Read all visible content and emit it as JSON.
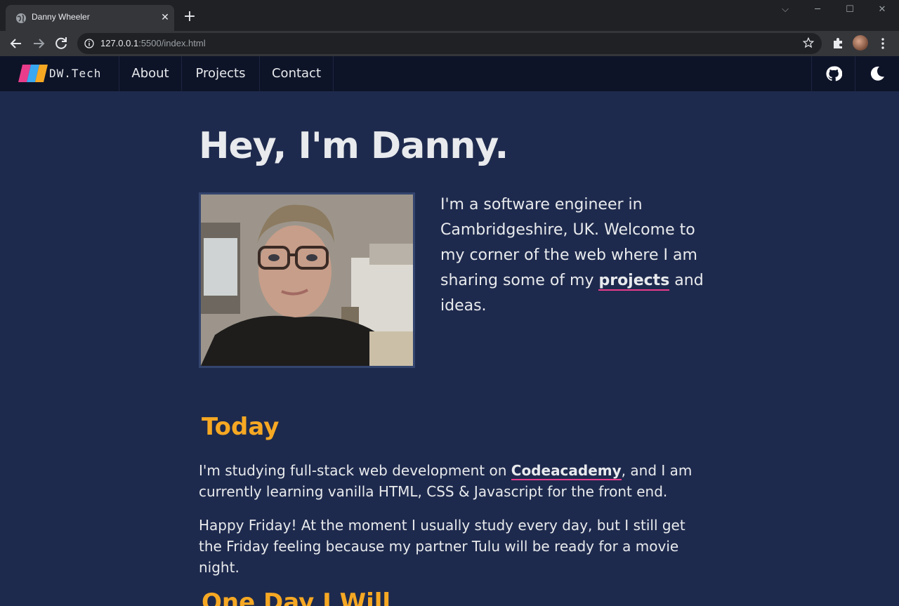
{
  "browser": {
    "tab_title": "Danny Wheeler",
    "new_tab_icon": "plus-icon",
    "url_host": "127.0.0.1",
    "url_rest": ":5500/index.html"
  },
  "site": {
    "logo_text": "DW.Tech",
    "nav": [
      "About",
      "Projects",
      "Contact"
    ],
    "icons": [
      "github-icon",
      "moon-icon"
    ],
    "colors": {
      "background": "#1e2a4d",
      "nav": "#0e1428",
      "accent": "#f6a823",
      "link_underline": "#e93d8c"
    }
  },
  "main": {
    "heading": "Hey, I'm Danny.",
    "intro_before": "I'm a software engineer in Cambridgeshire, UK. Welcome to my corner of the web where I am sharing some of my ",
    "intro_link": "projects",
    "intro_after": " and ideas.",
    "today_title": "Today",
    "today_p1_before": "I'm studying full-stack web development on ",
    "today_p1_link": "Codeacademy",
    "today_p1_after": ", and I am currently learning vanilla HTML, CSS & Javascript for the front end.",
    "today_p2": "Happy Friday! At the moment I usually study every day, but I still get the Friday feeling because my partner Tulu will be ready for a movie night.",
    "next_title": "One Day I Will"
  }
}
